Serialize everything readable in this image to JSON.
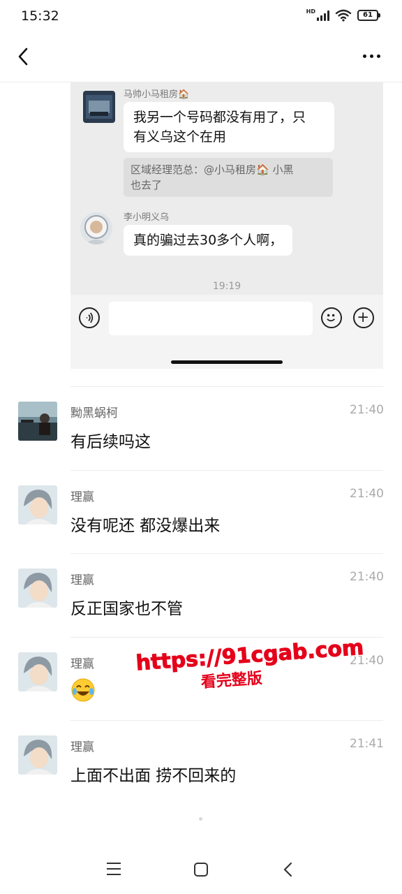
{
  "status_bar": {
    "time": "15:32",
    "network": "HD",
    "battery": "61"
  },
  "nav": {
    "back_icon": "chevron-left-icon",
    "more_icon": "more-dots-icon"
  },
  "embedded": {
    "msg1": {
      "sender": "马帅小马租房🏠",
      "text_line1": "我另一个号码都没有用了，只",
      "text_line2": "有义乌这个在用"
    },
    "quote": {
      "line1": "区域经理范总：@小马租房🏠 小黑",
      "line2": "也去了"
    },
    "msg2": {
      "sender": "李小明义乌",
      "text": "真的骗过去30多个人啊，"
    },
    "time": "19:19"
  },
  "comments": [
    {
      "name": "黝黑蜗柯",
      "time": "21:40",
      "text": "有后续吗这"
    },
    {
      "name": "理赢",
      "time": "21:40",
      "text": "没有呢还 都没爆出来"
    },
    {
      "name": "理赢",
      "time": "21:40",
      "text": "反正国家也不管"
    },
    {
      "name": "理赢",
      "time": "21:40",
      "text": "",
      "emoji": "tears-of-joy-emoji"
    },
    {
      "name": "理赢",
      "time": "21:41",
      "text": "上面不出面 捞不回来的"
    }
  ],
  "watermark": {
    "url": "https://91cgab.com",
    "subtitle": "看完整版"
  },
  "colors": {
    "watermark": "#e5001a",
    "embed_bg": "#ececec"
  }
}
